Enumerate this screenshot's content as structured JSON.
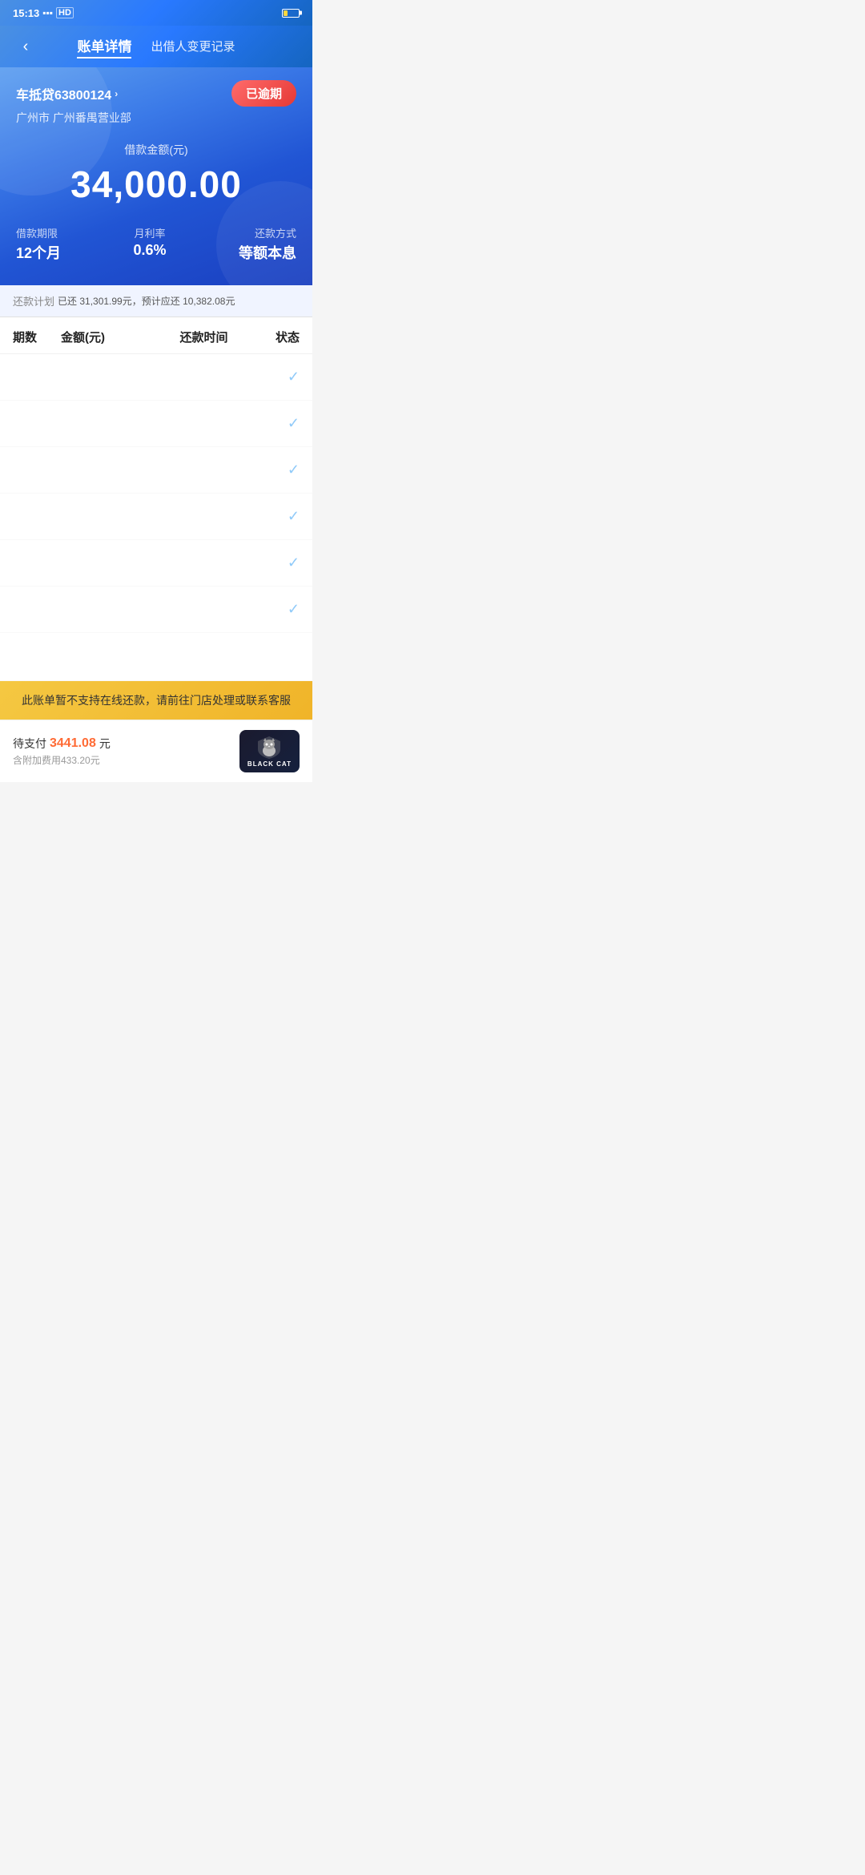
{
  "statusBar": {
    "time": "15:13",
    "signal": "HD",
    "batteryLevel": 25
  },
  "header": {
    "backLabel": "‹",
    "activeTab": "账单详情",
    "secondaryTab": "出借人变更记录"
  },
  "loanCard": {
    "loanId": "车抵贷63800124",
    "chevron": "›",
    "overdueBadge": "已逾期",
    "branch": "广州市 广州番禺营业部",
    "amountLabel": "借款金额(元)",
    "amount": "34,000.00",
    "termLabel": "借款期限",
    "termValue": "12个月",
    "rateLabel": "月利率",
    "rateValue": "0.6%",
    "methodLabel": "还款方式",
    "methodValue": "等额本息"
  },
  "summaryBar": {
    "label": "还款计划",
    "paidText": "已还 31,301.99元，预计应还 10,382.08元"
  },
  "tableHeader": {
    "col1": "期数",
    "col2": "金额(元)",
    "col3": "还款时间",
    "col4": "状态"
  },
  "tableRows": [
    {
      "period": "",
      "amount": "",
      "date": "",
      "status": "✓"
    },
    {
      "period": "",
      "amount": "",
      "date": "",
      "status": "✓"
    },
    {
      "period": "",
      "amount": "",
      "date": "",
      "status": "✓"
    },
    {
      "period": "",
      "amount": "",
      "date": "",
      "status": "✓"
    },
    {
      "period": "",
      "amount": "",
      "date": "",
      "status": "✓"
    },
    {
      "period": "",
      "amount": "",
      "date": "",
      "status": "✓"
    }
  ],
  "noticeBar": {
    "text": "此账单暂不支持在线还款，请前往门店处理或联系客服"
  },
  "footer": {
    "pendingLabel": "待支付",
    "pendingAmount": "3441.08",
    "pendingUnit": "元",
    "extraFee": "含附加费用433.20元"
  },
  "blackCat": {
    "label": "黑猫",
    "subLabel": "BLACK CAT"
  }
}
